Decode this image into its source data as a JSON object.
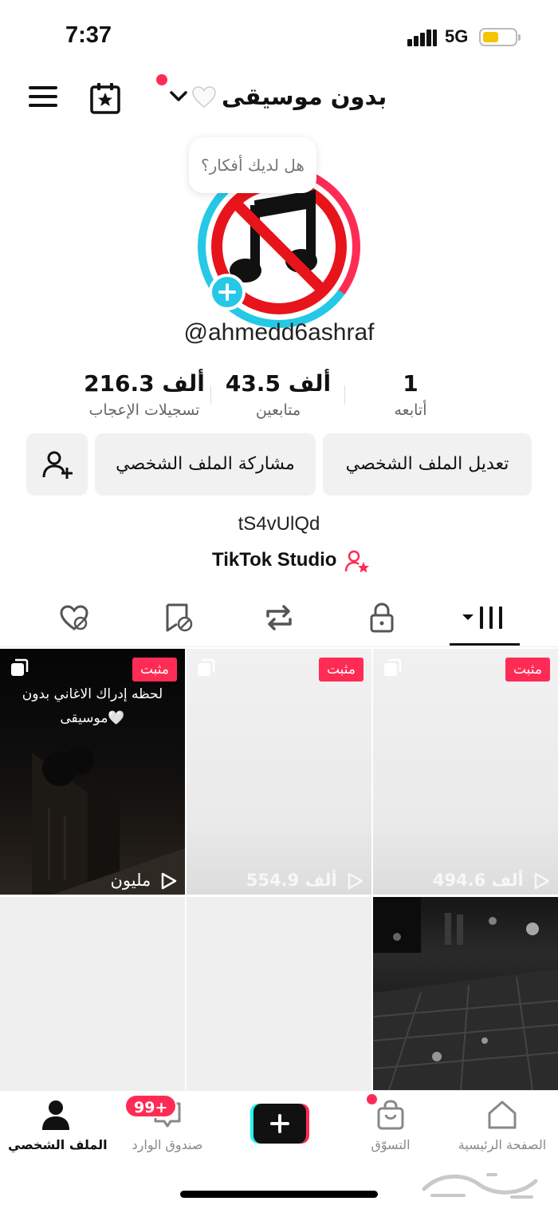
{
  "status_bar": {
    "time": "7:37",
    "network": "5G",
    "battery_color": "#f5c400"
  },
  "header": {
    "title": "بدون موسيقى",
    "title_emoji": "heart-icon"
  },
  "profile": {
    "bubble": "هل لديك أفكار؟",
    "handle": "@ahmedd6ashraf",
    "stats": {
      "following_value": "1",
      "following_label": "أتابعه",
      "followers_value": "43.5 ألف",
      "followers_label": "متابعين",
      "likes_value": "216.3 ألف",
      "likes_label": "تسجيلات الإعجاب"
    },
    "edit_button": "تعديل الملف الشخصي",
    "share_button": "مشاركة الملف الشخصي",
    "bio": "tS4vUlQd",
    "studio": "TikTok Studio"
  },
  "grid": {
    "pinned_label": "مثبت",
    "videos": [
      {
        "caption": "لحظه إدراك الاغاني بدون موسيقى🤍",
        "views": "مليون"
      },
      {
        "caption": "",
        "views": "554.9 ألف"
      },
      {
        "caption": "",
        "views": "494.6 ألف"
      }
    ]
  },
  "bottom_nav": {
    "profile": "الملف الشخصي",
    "inbox": "صندوق الوارد",
    "inbox_badge": "99+",
    "shop": "التسوّق",
    "home": "الصفحة الرئيسية"
  },
  "colors": {
    "accent": "#fe2c55",
    "cyan": "#25c8e6"
  }
}
